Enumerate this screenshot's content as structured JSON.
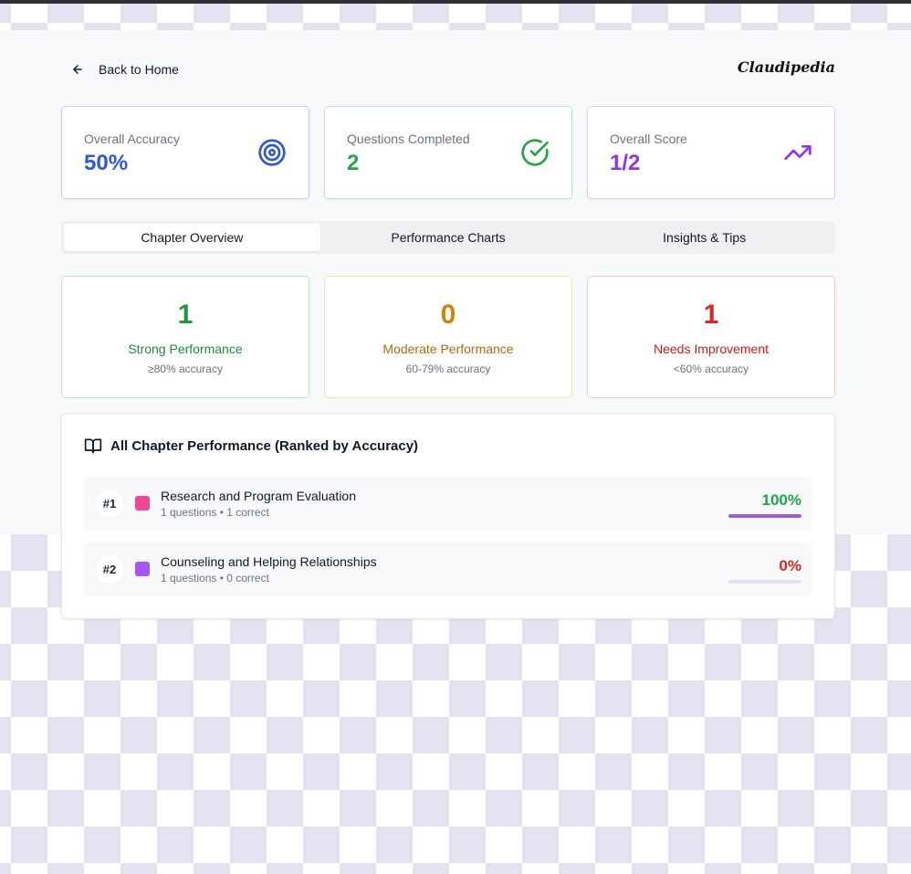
{
  "nav": {
    "back_label": "Back to Home",
    "brand": "Claudipedia"
  },
  "stats": [
    {
      "label": "Overall Accuracy",
      "value": "50%",
      "color": "#2f58d6",
      "icon": "target-icon"
    },
    {
      "label": "Questions Completed",
      "value": "2",
      "color": "#27a34b",
      "icon": "check-circle-icon"
    },
    {
      "label": "Overall Score",
      "value": "1/2",
      "color": "#9333ea",
      "icon": "trending-up-icon"
    }
  ],
  "tabs": [
    {
      "label": "Chapter Overview",
      "active": true
    },
    {
      "label": "Performance Charts",
      "active": false
    },
    {
      "label": "Insights & Tips",
      "active": false
    }
  ],
  "performance": [
    {
      "count": "1",
      "title": "Strong Performance",
      "sub": "≥80% accuracy",
      "color": "#23963f",
      "title_color": "#1f8b3a"
    },
    {
      "count": "0",
      "title": "Moderate Performance",
      "sub": "60-79% accuracy",
      "color": "#c8860d",
      "title_color": "#b06c0c"
    },
    {
      "count": "1",
      "title": "Needs Improvement",
      "sub": "<60% accuracy",
      "color": "#dc2626",
      "title_color": "#c81e1e"
    }
  ],
  "chapters": {
    "title": "All Chapter Performance (Ranked by Accuracy)",
    "items": [
      {
        "rank": "#1",
        "name": "Research and Program Evaluation",
        "meta": "1 questions • 1 correct",
        "percent": "100%",
        "accuracy": 1.0,
        "swatch": "#ec4899",
        "pct_color": "#22a34a"
      },
      {
        "rank": "#2",
        "name": "Counseling and Helping Relationships",
        "meta": "1 questions • 0 correct",
        "percent": "0%",
        "accuracy": 0.0,
        "swatch": "#a855f7",
        "pct_color": "#dc2626"
      }
    ]
  }
}
